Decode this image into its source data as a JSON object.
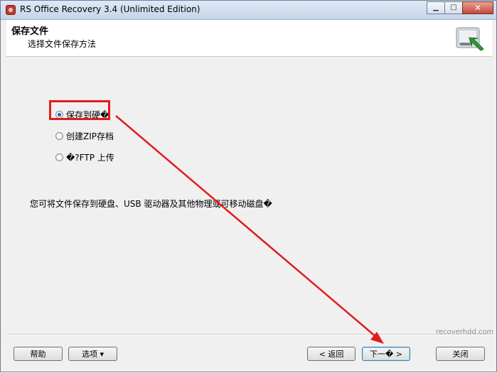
{
  "window": {
    "title": "RS Office Recovery 3.4 (Unlimited Edition)",
    "controls": {
      "minimize": "▁",
      "maximize": "□",
      "close": "✕"
    }
  },
  "header": {
    "title": "保存文件",
    "subtitle": "选择文件保存方法",
    "icon": "hard-drive-arrow-icon"
  },
  "options": [
    {
      "label": "保存到硬�",
      "checked": true
    },
    {
      "label": "创建ZIP存档",
      "checked": false
    },
    {
      "label": "�?FTP 上传",
      "checked": false
    }
  ],
  "description": "您可将文件保存到硬盘、USB 驱动器及其他物理或可移动磁盘�",
  "watermark": "recoverhdd.com",
  "buttons": {
    "help": "帮助",
    "options": "选项 ▾",
    "back": "< 返回",
    "next": "下一� >",
    "close": "关闭"
  },
  "annotation_color": "#e21b1b"
}
